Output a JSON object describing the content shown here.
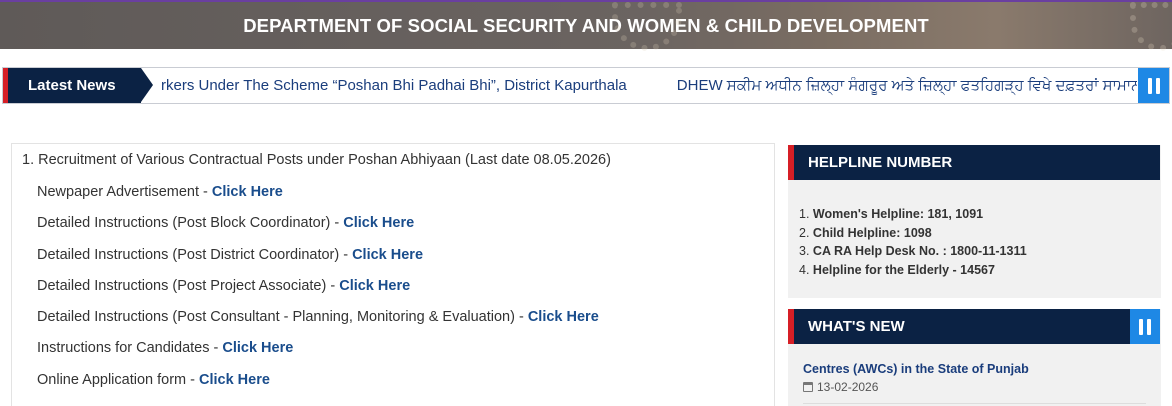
{
  "header": {
    "title": "DEPARTMENT OF SOCIAL SECURITY AND WOMEN & CHILD DEVELOPMENT"
  },
  "ticker": {
    "label": "Latest News",
    "items": [
      "rkers Under The Scheme “Poshan Bhi Padhai Bhi”, District Kapurthala",
      "DHEW ਸਕੀਮ ਅਧੀਨ ਜ਼ਿਲ੍ਹਾ ਸੰਗਰੂਰ ਅਤੇ ਜ਼ਿਲ੍ਹਾ ਫਤਹਿਗੜ੍ਹ ਵਿਖੇ ਦਫ਼ਤਰਾਂ ਸਾਮਾਨ ਖਰ"
    ],
    "pause_icon": "pause-icon"
  },
  "recruitment": {
    "title": "1. Recruitment of Various Contractual Posts under Poshan Abhiyaan (Last date 08.05.2026)",
    "rows": [
      {
        "text": "Newpaper Advertisement - ",
        "link": "Click Here"
      },
      {
        "text": "Detailed Instructions (Post Block Coordinator) - ",
        "link": "Click Here"
      },
      {
        "text": "Detailed Instructions (Post District Coordinator) - ",
        "link": "Click Here"
      },
      {
        "text": "Detailed Instructions (Post Project Associate) - ",
        "link": "Click Here"
      },
      {
        "text": "Detailed Instructions (Post Consultant - Planning, Monitoring & Evaluation) - ",
        "link": "Click Here"
      },
      {
        "text": "Instructions for Candidates - ",
        "link": "Click Here"
      },
      {
        "text": "Online Application form - ",
        "link": "Click Here"
      }
    ]
  },
  "helpline": {
    "title": "HELPLINE NUMBER",
    "items": [
      {
        "num": "1.",
        "text": "Women's Helpline: 181, 1091"
      },
      {
        "num": "2.",
        "text": "Child Helpline: 1098"
      },
      {
        "num": "3.",
        "text": "CA RA Help Desk No. : 1800-11-1311"
      },
      {
        "num": "4.",
        "text": "Helpline for the Elderly - 14567"
      }
    ]
  },
  "whats_new": {
    "title": "WHAT'S NEW",
    "item_title": "Centres (AWCs) in the State of Punjab",
    "item_date": "13-02-2026"
  },
  "colors": {
    "navy": "#0b2244",
    "accent_red": "#d61f26",
    "accent_blue": "#1e88e5",
    "link_blue": "#1a4d8c"
  }
}
